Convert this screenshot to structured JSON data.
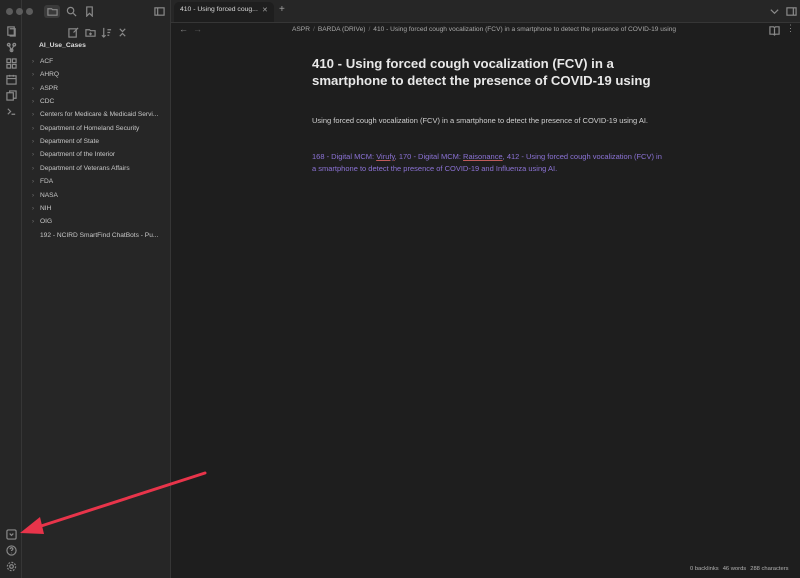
{
  "sidebar": {
    "vault_name": "AI_Use_Cases",
    "items": [
      {
        "label": "ACF",
        "folder": true
      },
      {
        "label": "AHRQ",
        "folder": true
      },
      {
        "label": "ASPR",
        "folder": true
      },
      {
        "label": "CDC",
        "folder": true
      },
      {
        "label": "Centers for Medicare & Medicaid Servi...",
        "folder": true
      },
      {
        "label": "Department of Homeland Security",
        "folder": true
      },
      {
        "label": "Department of State",
        "folder": true
      },
      {
        "label": "Department of the Interior",
        "folder": true
      },
      {
        "label": "Department of Veterans Affairs",
        "folder": true
      },
      {
        "label": "FDA",
        "folder": true
      },
      {
        "label": "NASA",
        "folder": true
      },
      {
        "label": "NIH",
        "folder": true
      },
      {
        "label": "OIG",
        "folder": true
      },
      {
        "label": "192 - NCIRD SmartFind ChatBots - Pu...",
        "folder": false
      }
    ]
  },
  "tab": {
    "title": "410 - Using forced coug...",
    "new_tab": "+",
    "close": "✕"
  },
  "breadcrumb": {
    "parts": [
      "ASPR",
      "BARDA (DRIVe)",
      "410 - Using forced cough vocalization (FCV) in a smartphone to detect the presence of COVID-19 using"
    ],
    "separator": "/"
  },
  "document": {
    "title": "410 - Using forced cough vocalization (FCV) in a smartphone to detect the presence of COVID-19 using",
    "description": "Using forced cough vocalization (FCV) in a smartphone to detect the presence of COVID-19 using AI.",
    "links": {
      "l1_prefix": "168 - Digital MCM: ",
      "l1_name": "Virufy",
      "l2_prefix": "170 - Digital MCM: ",
      "l2_name": "Raisonance",
      "l3": "412 - Using forced cough vocalization (FCV) in a smartphone to detect the presence of COVID-19 and Influenza using AI.",
      "sep": ", "
    }
  },
  "status": {
    "backlinks": "0 backlinks",
    "words": "46 words",
    "characters": "288 characters"
  },
  "colors": {
    "link": "#8c73d6",
    "arrow": "#e8344a",
    "background": "#1e1e1e",
    "sidebar": "#262626"
  }
}
